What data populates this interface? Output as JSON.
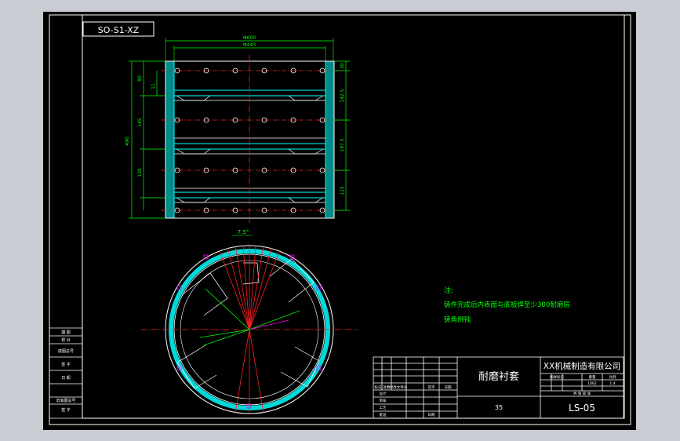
{
  "drawing": {
    "code_box": "SO-S1-XZ",
    "title": "耐磨衬套",
    "company": "XX机械制造有限公司",
    "drawing_number": "LS-05",
    "material_code": "35",
    "scale": "1:4",
    "weight": "1062",
    "angle_label": "7.5°"
  },
  "notes": {
    "heading": "注:",
    "lines": [
      "铸件完成后内表面与底板焊至少300耐磨层",
      "铸角倒钝"
    ]
  },
  "dimensions": {
    "top_overall": "Φ600",
    "top_inner": "Φ443",
    "left_total": "490",
    "right_seg_1": "30",
    "right_seg_2": "142.5",
    "right_seg_3": "197.5",
    "right_seg_4": "115",
    "left_seg_1": "80",
    "left_seg_2": "145",
    "left_seg_3": "130",
    "small_dim": "11"
  },
  "title_block": {
    "rev_headers": [
      "标记",
      "处数",
      "更改文件号",
      "签字",
      "日期"
    ],
    "roles": [
      "设计",
      "审核",
      "工艺",
      "批准"
    ],
    "cols": [
      "图样标记",
      "重量",
      "比例"
    ],
    "sheet": "共 张  第 张",
    "date_label": "日期"
  },
  "side_block": {
    "rows": [
      "描 图",
      "校 对",
      "底图总号",
      "签 字",
      "日 期",
      "旧底图总号",
      "签 字"
    ]
  },
  "colors": {
    "sheet": "#000000",
    "line": "#ffffff",
    "cyan": "#00ffff",
    "green": "#00ff00",
    "red": "#ff2020",
    "magenta": "#ff00ff",
    "yellow": "#ffff00",
    "frame_bg": "#c9cdd3"
  }
}
